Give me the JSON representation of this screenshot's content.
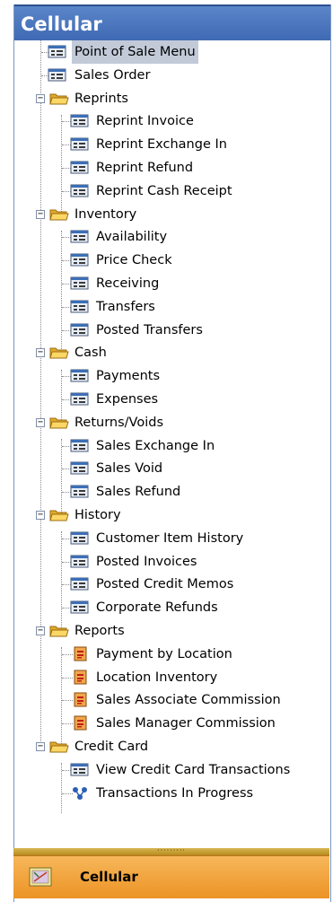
{
  "panel": {
    "title": "Cellular"
  },
  "tree": {
    "point_of_sale_menu": "Point of Sale Menu",
    "sales_order": "Sales Order",
    "reprints": {
      "label": "Reprints",
      "expander": "−",
      "items": [
        "Reprint Invoice",
        "Reprint Exchange In",
        "Reprint Refund",
        "Reprint Cash Receipt"
      ]
    },
    "inventory": {
      "label": "Inventory",
      "expander": "−",
      "items": [
        "Availability",
        "Price Check",
        "Receiving",
        "Transfers",
        "Posted Transfers"
      ]
    },
    "cash": {
      "label": "Cash",
      "expander": "−",
      "items": [
        "Payments",
        "Expenses"
      ]
    },
    "returns_voids": {
      "label": "Returns/Voids",
      "expander": "−",
      "items": [
        "Sales Exchange In",
        "Sales Void",
        "Sales Refund"
      ]
    },
    "history": {
      "label": "History",
      "expander": "−",
      "items": [
        "Customer Item History",
        "Posted Invoices",
        "Posted Credit Memos",
        "Corporate Refunds"
      ]
    },
    "reports": {
      "label": "Reports",
      "expander": "−",
      "items": [
        "Payment by Location",
        "Location Inventory",
        "Sales Associate Commission",
        "Sales Manager Commission"
      ]
    },
    "credit_card": {
      "label": "Credit Card",
      "expander": "−",
      "items": [
        "View Credit Card Transactions",
        "Transactions In Progress"
      ]
    }
  },
  "splitter": {
    "grip": "·········"
  },
  "bottom_button": {
    "label": "Cellular"
  },
  "colors": {
    "title_bar": "#4a76bf",
    "selection": "#c2cad8",
    "bottom_bar": "#f2a43d",
    "folder": "#f2c744"
  }
}
